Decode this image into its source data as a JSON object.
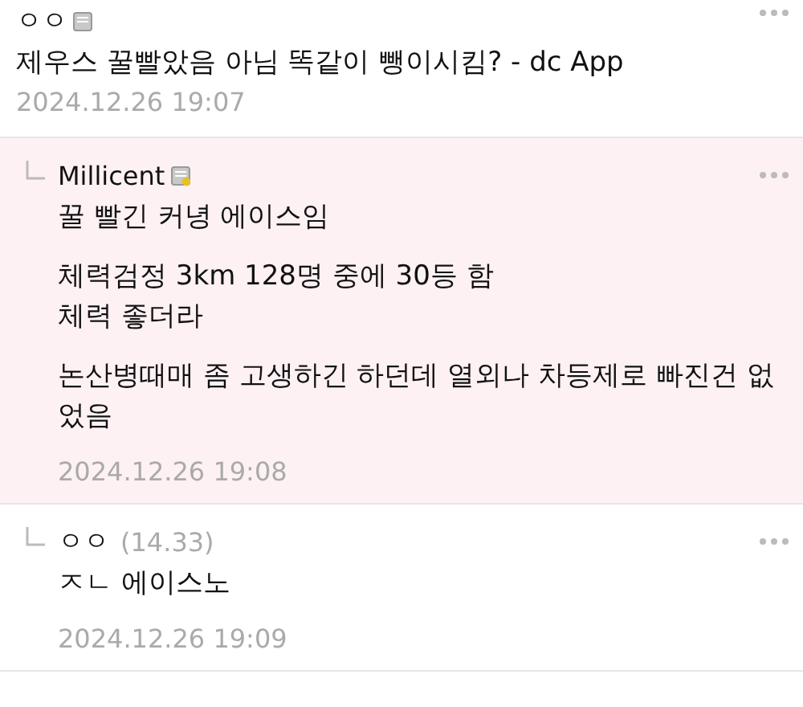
{
  "comments": [
    {
      "kind": "post",
      "author": "ㅇㅇ",
      "badge": true,
      "badge_dot": false,
      "text": "제우스 꿀빨았음 아님 똑같이 뺑이시킴? - dc App",
      "time": "2024.12.26 19:07",
      "highlighted": false
    },
    {
      "kind": "reply",
      "author": "Millicent",
      "badge": true,
      "badge_dot": true,
      "paragraphs": [
        "꿀 빨긴 커녕 에이스임",
        "체력검정 3km 128명 중에 30등 함\n체력 좋더라",
        "논산병때매 좀 고생하긴 하던데 열외나 차등제로 빠진건 없었음"
      ],
      "time": "2024.12.26 19:08",
      "highlighted": true
    },
    {
      "kind": "reply",
      "author": "ㅇㅇ",
      "badge": false,
      "ip": "(14.33)",
      "paragraphs": [
        "ㅈㄴ 에이스노"
      ],
      "time": "2024.12.26 19:09",
      "highlighted": false
    }
  ]
}
